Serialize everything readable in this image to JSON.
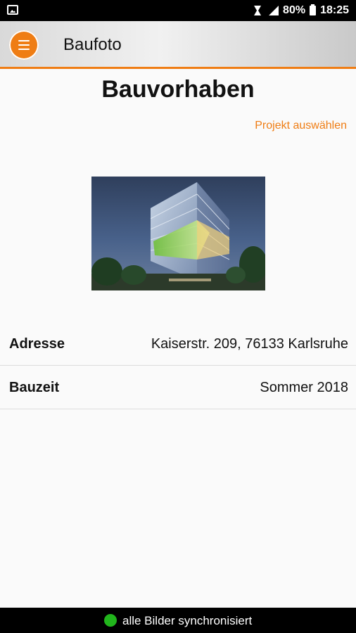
{
  "status_bar": {
    "battery_percent": "80%",
    "time": "18:25"
  },
  "app_bar": {
    "title": "Baufoto"
  },
  "page": {
    "title": "Bauvorhaben",
    "select_project_link": "Projekt auswählen"
  },
  "details": [
    {
      "label": "Adresse",
      "value": "Kaiserstr. 209, 76133 Karlsruhe"
    },
    {
      "label": "Bauzeit",
      "value": "Sommer 2018"
    }
  ],
  "footer": {
    "sync_status": "alle Bilder synchronisiert",
    "sync_color": "#21b51c"
  },
  "colors": {
    "accent": "#ef7d14"
  }
}
